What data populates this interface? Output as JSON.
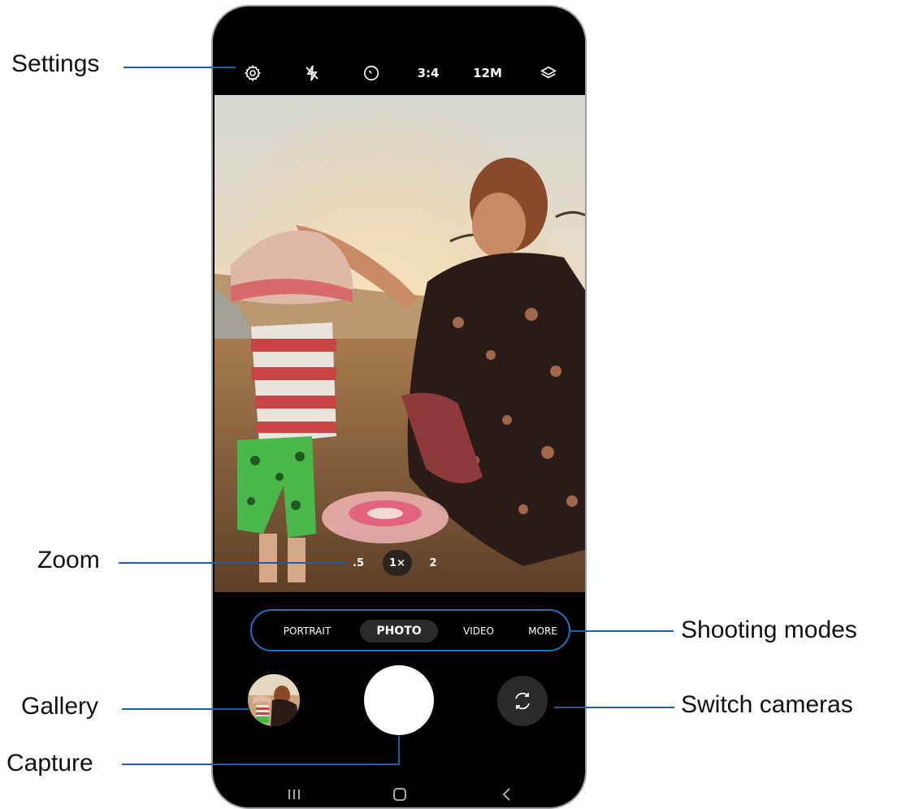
{
  "top_bar": {
    "settings_icon": "gear-icon",
    "flash_icon": "flash-off-icon",
    "timer_icon": "timer-icon",
    "ratio": "3:4",
    "resolution": "12M",
    "filters_icon": "layers-icon"
  },
  "zoom": {
    "levels": [
      ".5",
      "1×",
      "2"
    ],
    "active": "1×"
  },
  "modes": {
    "items": [
      "PORTRAIT",
      "PHOTO",
      "VIDEO",
      "MORE"
    ],
    "active": "PHOTO"
  },
  "controls": {
    "gallery_icon": "gallery-thumbnail",
    "capture_icon": "shutter-button",
    "switch_icon": "switch-camera-icon"
  },
  "nav_bar": {
    "recents_icon": "recents-icon",
    "home_icon": "home-icon",
    "back_icon": "back-icon"
  },
  "callouts": {
    "settings": "Settings",
    "zoom": "Zoom",
    "gallery": "Gallery",
    "capture": "Capture",
    "shooting_modes": "Shooting modes",
    "switch_cameras": "Switch cameras"
  },
  "colors": {
    "leader_line": "#1f5fa8",
    "mode_outline": "#1e73be",
    "phone_bg": "#000000"
  }
}
